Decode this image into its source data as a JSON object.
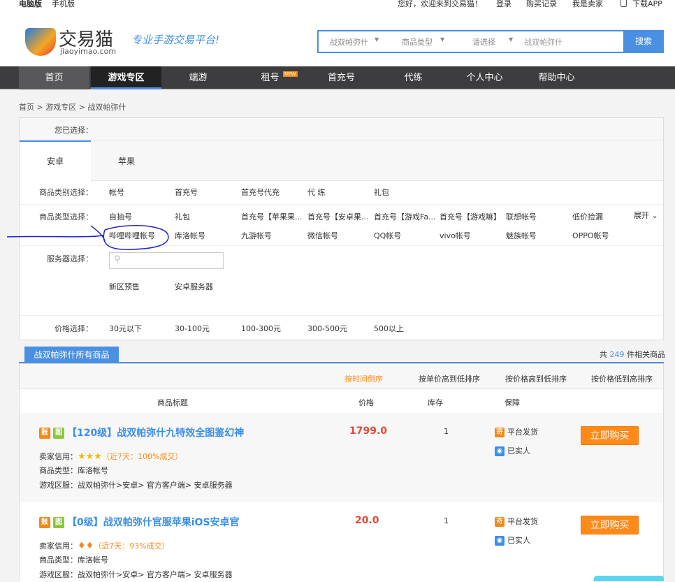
{
  "topbar": {
    "pc": "电脑版",
    "mobile": "手机版",
    "welcome": "您好，欢迎来到交易猫！",
    "login": "登录",
    "orders": "购买记录",
    "seller": "我是卖家",
    "app": "下载APP"
  },
  "header": {
    "logo_text": "交易猫",
    "logo_domain": "jiaoyimao.com",
    "slogan": "专业手游交易平台!",
    "search": {
      "game": "战双帕弥什",
      "type": "商品类型",
      "choose": "请选择",
      "input_value": "战双帕弥什",
      "button": "搜索"
    }
  },
  "nav": {
    "items": [
      "首页",
      "游戏专区",
      "端游",
      "租号",
      "首充号",
      "代练",
      "个人中心",
      "帮助中心"
    ],
    "new_badge": "NEW"
  },
  "breadcrumb": "首页 > 游戏专区 > 战双帕弥什",
  "filter": {
    "selected_label": "您已选择：",
    "tabs": [
      "安卓",
      "苹果"
    ],
    "category_label": "商品类别选择：",
    "categories": [
      "帐号",
      "首充号",
      "首充号代充",
      "代 练",
      "礼包"
    ],
    "type_label": "商品类型选择：",
    "types": [
      "自抽号",
      "礼包",
      "首充号【苹果果...",
      "首充号【安卓果...",
      "首充号【游戏Fa...",
      "首充号【游戏嘛】",
      "联想帐号",
      "低价捡漏",
      "哔哩哔哩帐号",
      "库洛帐号",
      "九游帐号",
      "微信帐号",
      "QQ帐号",
      "vivo帐号",
      "魅族帐号",
      "OPPO帐号"
    ],
    "expand": "展开",
    "server_label": "服务器选择：",
    "servers": [
      "新区预售",
      "安卓服务器"
    ],
    "price_label": "价格选择：",
    "prices": [
      "30元以下",
      "30-100元",
      "100-300元",
      "300-500元",
      "500以上"
    ]
  },
  "list": {
    "title": "战双帕弥什所有商品",
    "count_prefix": "共",
    "count": "249",
    "count_suffix": "件相关商品",
    "sorts": [
      "按时间倒序",
      "按单价高到低排序",
      "按价格高到低排序",
      "按价格低到高排序"
    ],
    "columns": [
      "商品标题",
      "价格",
      "库存",
      "保障"
    ],
    "products": [
      {
        "badge1": "账",
        "badge2": "图",
        "title": "【120级】战双帕弥什九特效全图鉴幻神",
        "price": "1799.0",
        "stock": "1",
        "guarantee1": "平台发货",
        "guarantee2": "已实人",
        "credit_label": "卖家信用：",
        "credit_note": "（近7天：100%成交）",
        "type_label": "商品类型：",
        "type": "库洛帐号",
        "server_label": "游戏区服：",
        "server": "战双帕弥什>安卓> 官方客户端> 安卓服务器",
        "buy": "立即购买"
      },
      {
        "badge1": "账",
        "badge2": "图",
        "title": "【0级】战双帕弥什官服苹果iOS安卓官",
        "price": "20.0",
        "stock": "1",
        "guarantee1": "平台发货",
        "guarantee2": "已实人",
        "credit_label": "卖家信用：",
        "credit_note": "（近7天：93%成交）",
        "type_label": "商品类型：",
        "type": "库洛帐号",
        "server_label": "游戏区服：",
        "server": "战双帕弥什>安卓> 官方客户端> 安卓服务器",
        "buy": "立即购买"
      }
    ]
  },
  "colors": {
    "accent": "#4a90e2",
    "orange": "#ff8a1a",
    "price": "#e04a3a",
    "nav": "#3d3d3f"
  }
}
